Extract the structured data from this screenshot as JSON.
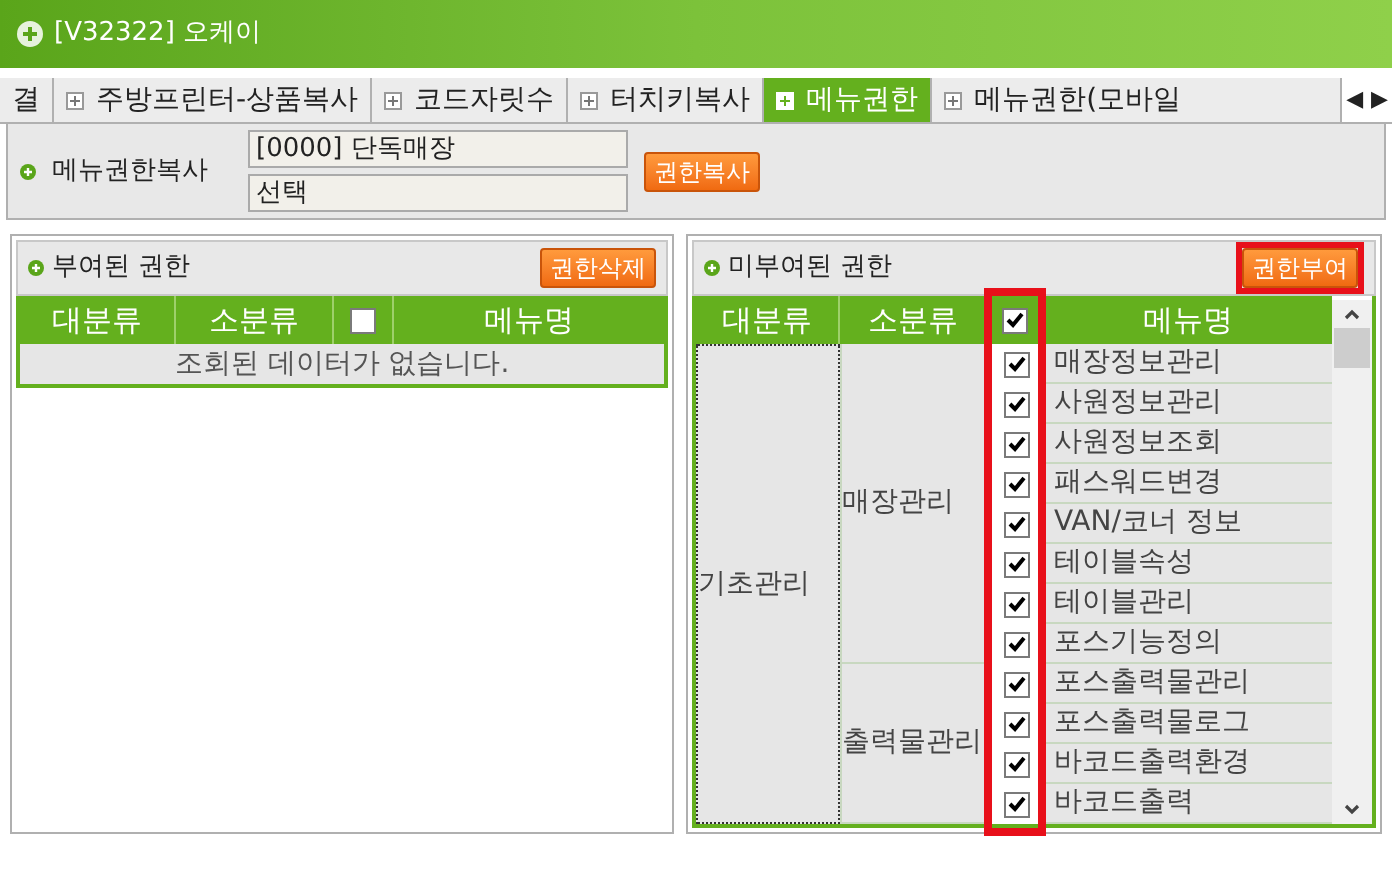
{
  "window": {
    "title": "[V32322] 오케이"
  },
  "tabs": [
    {
      "label": "결",
      "selected": false,
      "icon": false
    },
    {
      "label": "주방프린터-상품복사",
      "selected": false,
      "icon": true
    },
    {
      "label": "코드자릿수",
      "selected": false,
      "icon": true
    },
    {
      "label": "터치키복사",
      "selected": false,
      "icon": true
    },
    {
      "label": "메뉴권한",
      "selected": true,
      "icon": true
    },
    {
      "label": "메뉴권한(모바일",
      "selected": false,
      "icon": true
    }
  ],
  "tab_scroll": {
    "prev": "◀",
    "next": "▶"
  },
  "copy_panel": {
    "label": "메뉴권한복사",
    "source": "[0000] 단독매장",
    "target": "선택",
    "button": "권한복사"
  },
  "granted": {
    "title": "부여된 권한",
    "button": "권한삭제",
    "columns": [
      "대분류",
      "소분류",
      "메뉴명"
    ],
    "all_checked": false,
    "empty_message": "조회된 데이터가 없습니다."
  },
  "ungranted": {
    "title": "미부여된 권한",
    "button": "권한부여",
    "button_highlighted": true,
    "check_column_highlighted": true,
    "columns": [
      "대분류",
      "소분류",
      "메뉴명"
    ],
    "all_checked": true,
    "groups": [
      {
        "name": "기초관리",
        "children": [
          {
            "name": "매장관리",
            "items": [
              {
                "name": "매장정보관리",
                "checked": true
              },
              {
                "name": "사원정보관리",
                "checked": true
              },
              {
                "name": "사원정보조회",
                "checked": true
              },
              {
                "name": "패스워드변경",
                "checked": true
              },
              {
                "name": "VAN/코너 정보",
                "checked": true
              },
              {
                "name": "테이블속성",
                "checked": true
              },
              {
                "name": "테이블관리",
                "checked": true
              },
              {
                "name": "포스기능정의",
                "checked": true
              }
            ]
          },
          {
            "name": "출력물관리",
            "items": [
              {
                "name": "포스출력물관리",
                "checked": true
              },
              {
                "name": "포스출력물로그",
                "checked": true
              },
              {
                "name": "바코드출력환경",
                "checked": true
              },
              {
                "name": "바코드출력",
                "checked": true
              }
            ]
          }
        ]
      }
    ]
  }
}
